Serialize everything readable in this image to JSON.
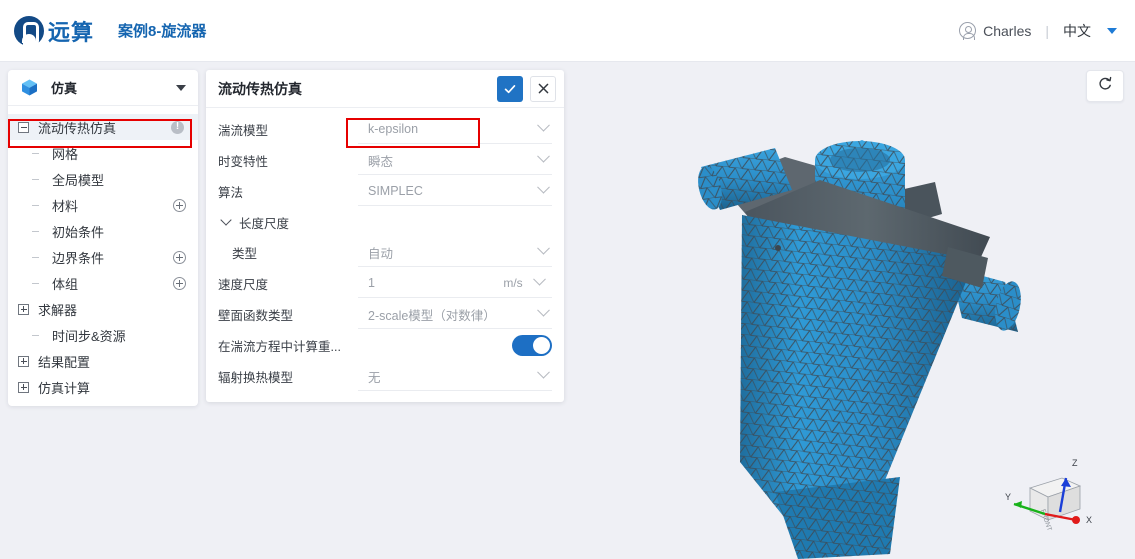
{
  "header": {
    "logo_text": "远算",
    "project_title": "案例8-旋流器",
    "user_name": "Charles",
    "separator": "|",
    "language": "中文",
    "caret_icon": "chevron-down-icon",
    "avatar_icon": "user-avatar-icon"
  },
  "sidebar": {
    "header_label": "仿真",
    "header_icon": "cube-icon",
    "collapse_icon": "chevron-down-icon",
    "tree": [
      {
        "label": "流动传热仿真",
        "level": 1,
        "toggle": "minus",
        "selected": true,
        "badge": "!",
        "action": null
      },
      {
        "label": "网格",
        "level": 2,
        "toggle": "dash",
        "selected": false,
        "badge": null,
        "action": null
      },
      {
        "label": "全局模型",
        "level": 2,
        "toggle": "dash",
        "selected": false,
        "badge": null,
        "action": null
      },
      {
        "label": "材料",
        "level": 2,
        "toggle": "dash",
        "selected": false,
        "badge": null,
        "action": "add"
      },
      {
        "label": "初始条件",
        "level": 2,
        "toggle": "dash",
        "selected": false,
        "badge": null,
        "action": null
      },
      {
        "label": "边界条件",
        "level": 2,
        "toggle": "dash",
        "selected": false,
        "badge": null,
        "action": "add"
      },
      {
        "label": "体组",
        "level": 2,
        "toggle": "dash",
        "selected": false,
        "badge": null,
        "action": "add"
      },
      {
        "label": "求解器",
        "level": 1,
        "toggle": "plus",
        "selected": false,
        "badge": null,
        "action": null
      },
      {
        "label": "时间步&资源",
        "level": 2,
        "toggle": "dash",
        "selected": false,
        "badge": null,
        "action": null
      },
      {
        "label": "结果配置",
        "level": 1,
        "toggle": "plus",
        "selected": false,
        "badge": null,
        "action": null
      },
      {
        "label": "仿真计算",
        "level": 1,
        "toggle": "plus",
        "selected": false,
        "badge": null,
        "action": null
      }
    ]
  },
  "panel": {
    "title": "流动传热仿真",
    "confirm_icon": "check-icon",
    "cancel_icon": "close-icon",
    "rows": [
      {
        "kind": "select",
        "label": "湍流模型",
        "value": "k-epsilon",
        "unit": null,
        "highlight": true
      },
      {
        "kind": "select",
        "label": "时变特性",
        "value": "瞬态",
        "unit": null,
        "highlight": false
      },
      {
        "kind": "select",
        "label": "算法",
        "value": "SIMPLEC",
        "unit": null,
        "highlight": false
      },
      {
        "kind": "group",
        "label": "长度尺度",
        "value": null,
        "unit": null,
        "highlight": false
      },
      {
        "kind": "select-indent",
        "label": "类型",
        "value": "自动",
        "unit": null,
        "highlight": false
      },
      {
        "kind": "input-unit",
        "label": "速度尺度",
        "value": "1",
        "unit": "m/s",
        "highlight": false
      },
      {
        "kind": "select",
        "label": "壁面函数类型",
        "value": "2-scale模型（对数律）",
        "unit": null,
        "highlight": false
      },
      {
        "kind": "toggle",
        "label": "在湍流方程中计算重...",
        "value": "on",
        "unit": null,
        "highlight": false
      },
      {
        "kind": "select",
        "label": "辐射换热模型",
        "value": "无",
        "unit": null,
        "highlight": false
      }
    ]
  },
  "viewport": {
    "reset_icon": "refresh-view-icon",
    "axis": {
      "x_label": "X",
      "y_label": "Y",
      "z_label": "Z",
      "cube_face_label": "FRONT",
      "x_color": "#e01a1a",
      "y_color": "#18b21a",
      "z_color": "#1b3fd8"
    },
    "model_name": "cyclone-separator-mesh",
    "mesh_color": "#2a8fd0",
    "mesh_edge_color": "#3a4650",
    "background_color": "#eff0f5"
  },
  "colors": {
    "brand_blue": "#1565b0",
    "accent_blue": "#2073c4",
    "annotation_red": "#e60000",
    "panel_bg": "#ffffff",
    "app_bg": "#eff0f5"
  }
}
